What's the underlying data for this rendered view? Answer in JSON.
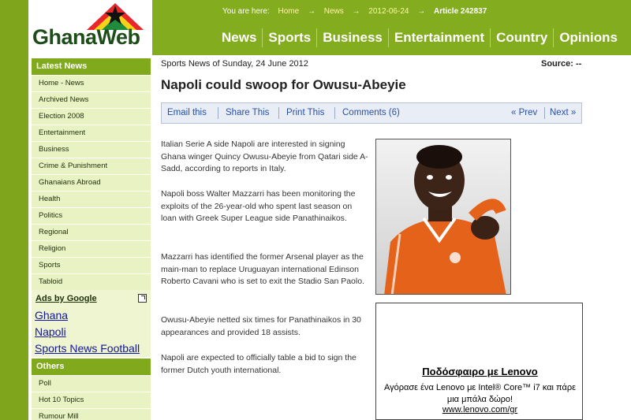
{
  "header": {
    "logo_text": "GhanaWeb",
    "breadcrumb": {
      "prefix": "You are here:",
      "items": [
        "Home",
        "News",
        "2012-06-24"
      ],
      "current": "Article 242837",
      "separator": "→"
    },
    "nav": [
      "News",
      "Sports",
      "Business",
      "Entertainment",
      "Country",
      "Opinions"
    ]
  },
  "sidebar": {
    "latest_heading": "Latest News",
    "items": [
      "Home - News",
      "Archived News",
      "Election 2008",
      "Entertainment",
      "Business",
      "Crime & Punishment",
      "Ghanaians Abroad",
      "Health",
      "Politics",
      "Regional",
      "Religion",
      "Sports",
      "Tabloid"
    ],
    "ads_heading": "Ads by Google",
    "ad_links": [
      "Ghana",
      "Napoli",
      "Sports News Football"
    ],
    "others_heading": "Others",
    "others_items": [
      "Poll",
      "Hot 10 Topics",
      "Rumour Mill"
    ]
  },
  "article": {
    "dateline": "Sports News of Sunday, 24 June 2012",
    "source": "Source: --",
    "headline": "Napoli could swoop for Owusu-Abeyie",
    "toolbar": {
      "email": "Email this",
      "share": "Share This",
      "print": "Print This",
      "comments": "Comments (6)",
      "prev": "« Prev",
      "next": "Next »"
    },
    "paragraphs": [
      "Italian Serie A side Napoli are interested in signing Ghana winger Quincy Owusu-Abeyie from Qatari side A-Sadd, according to reports in Italy.",
      "Napoli boss Walter Mazzarri has been monitoring the exploits of the 26-year-old who spent last season on loan with Greek Super League side Panathinaikos.",
      "Mazzarri has identified the former Arsenal player as the main-man to replace Uruguayan international Edinson Roberto Cavani who is set to exit the Stadio San Paolo.",
      "Owusu-Abeyie netted six times for Panathinaikos in 30 appearances and provided 18 assists.",
      "Napoli are expected to officially table a bid to sign the former Dutch youth international."
    ]
  },
  "ad_box": {
    "title": "Ποδόσφαιρο με Lenovo",
    "body": "Αγόρασε ένα Lenovo με Intel® Core™ i7 και πάρε μια μπάλα δώρο!",
    "url": "www.lenovo.com/gr"
  },
  "colors": {
    "header_green": "#83ac1e",
    "sidebar_bg": "#e9f2c2",
    "logo_text": "#1f4d1a",
    "toolbar_link": "#2850a8",
    "ad_link": "#13169a",
    "jersey_orange": "#e5621b"
  },
  "icons": {
    "logo": "ghana-flag-star-icon",
    "ads_external": "external-link-icon"
  }
}
